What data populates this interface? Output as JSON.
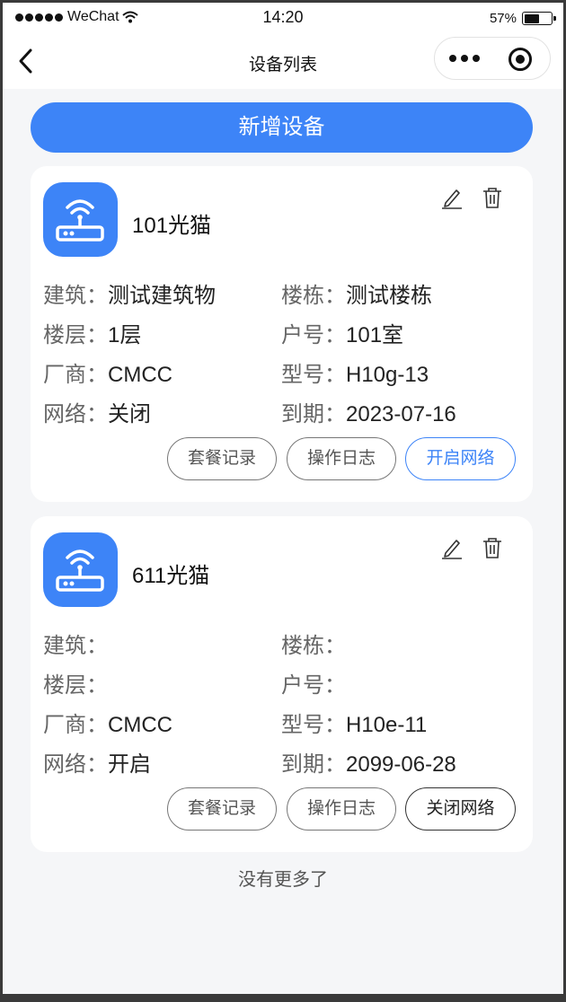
{
  "status_bar": {
    "carrier": "WeChat",
    "time": "14:20",
    "battery_text": "57%",
    "battery_level": 0.57
  },
  "nav": {
    "title": "设备列表",
    "back_icon": "chevron-left-icon",
    "more_icon": "more-dots-icon",
    "close_icon": "target-close-icon"
  },
  "add_button": {
    "label": "新增设备"
  },
  "colors": {
    "accent": "#3d84f7",
    "background": "#f5f6f8",
    "card": "#ffffff"
  },
  "devices": [
    {
      "name": "101光猫",
      "icon": "router-wifi-icon",
      "fields": {
        "building": {
          "label": "建筑：",
          "value": "测试建筑物"
        },
        "block": {
          "label": "楼栋：",
          "value": "测试楼栋"
        },
        "floor": {
          "label": "楼层：",
          "value": "1层"
        },
        "room": {
          "label": "户号：",
          "value": "101室"
        },
        "vendor": {
          "label": "厂商：",
          "value": "CMCC"
        },
        "model": {
          "label": "型号：",
          "value": "H10g-13"
        },
        "network": {
          "label": "网络：",
          "value": "关闭"
        },
        "expiry": {
          "label": "到期：",
          "value": "2023-07-16"
        }
      },
      "actions": {
        "plan": "套餐记录",
        "log": "操作日志",
        "net": "开启网络"
      }
    },
    {
      "name": "611光猫",
      "icon": "router-wifi-icon",
      "fields": {
        "building": {
          "label": "建筑：",
          "value": ""
        },
        "block": {
          "label": "楼栋：",
          "value": ""
        },
        "floor": {
          "label": "楼层：",
          "value": ""
        },
        "room": {
          "label": "户号：",
          "value": ""
        },
        "vendor": {
          "label": "厂商：",
          "value": "CMCC"
        },
        "model": {
          "label": "型号：",
          "value": "H10e-11"
        },
        "network": {
          "label": "网络：",
          "value": "开启"
        },
        "expiry": {
          "label": "到期：",
          "value": "2099-06-28"
        }
      },
      "actions": {
        "plan": "套餐记录",
        "log": "操作日志",
        "net": "关闭网络"
      }
    }
  ],
  "footer": {
    "no_more": "没有更多了"
  }
}
